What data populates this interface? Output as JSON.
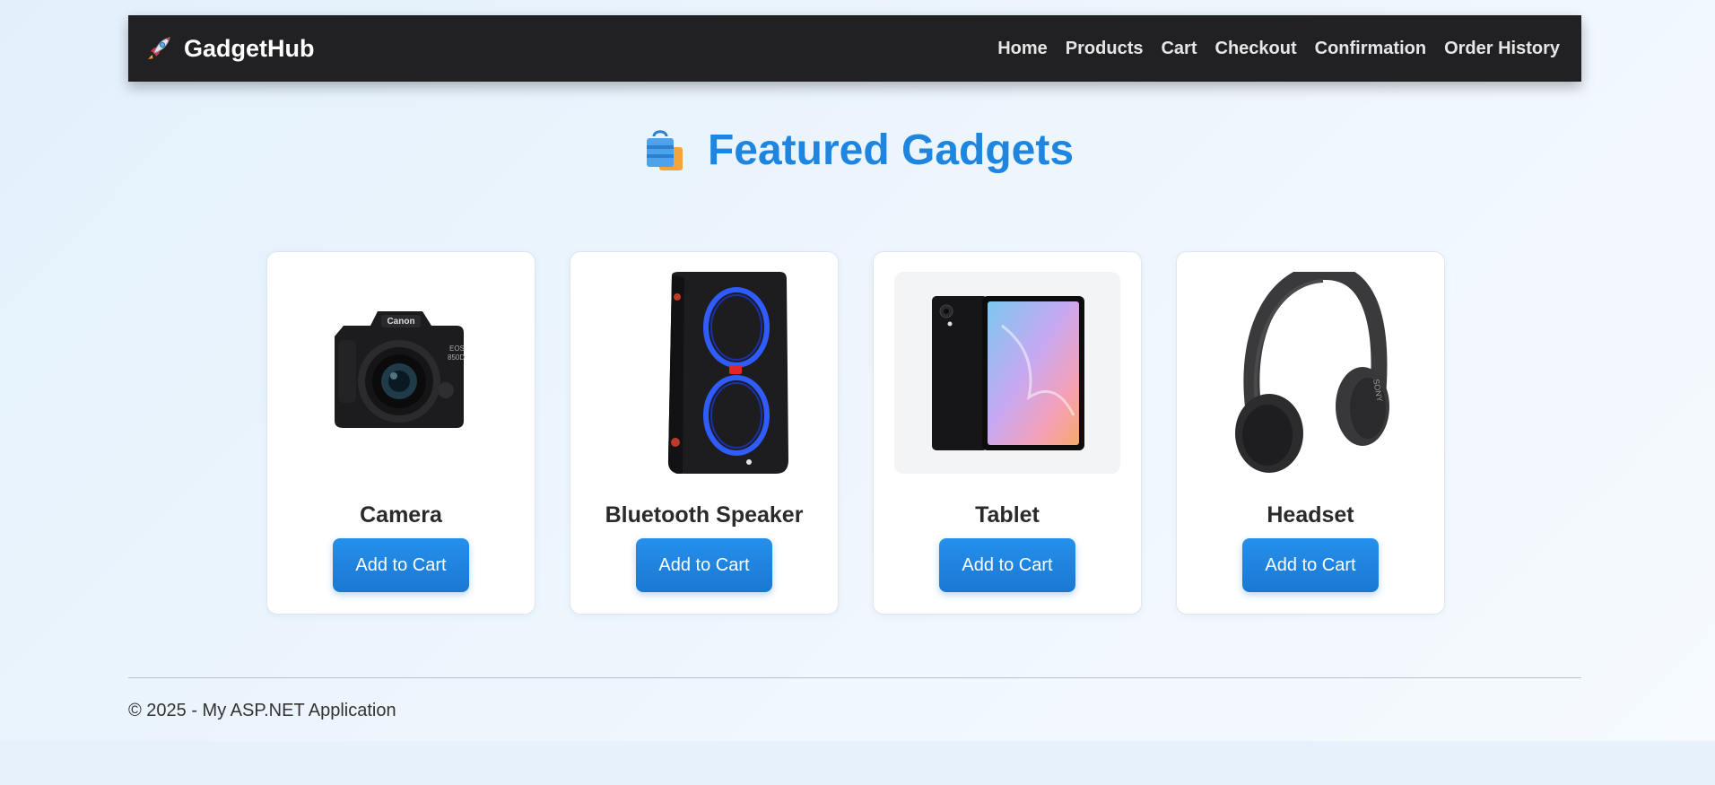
{
  "brand": {
    "name": "GadgetHub",
    "icon": "rocket-icon"
  },
  "nav": {
    "items": [
      {
        "label": "Home"
      },
      {
        "label": "Products"
      },
      {
        "label": "Cart"
      },
      {
        "label": "Checkout"
      },
      {
        "label": "Confirmation"
      },
      {
        "label": "Order History"
      }
    ]
  },
  "main": {
    "title": "Featured Gadgets",
    "title_icon": "shopping-bag-icon",
    "products": [
      {
        "name": "Camera",
        "button": "Add to Cart",
        "image": "camera-image"
      },
      {
        "name": "Bluetooth Speaker",
        "button": "Add to Cart",
        "image": "speaker-image"
      },
      {
        "name": "Tablet",
        "button": "Add to Cart",
        "image": "tablet-image"
      },
      {
        "name": "Headset",
        "button": "Add to Cart",
        "image": "headset-image"
      }
    ]
  },
  "footer": {
    "text": "© 2025 - My ASP.NET Application"
  },
  "colors": {
    "navbar": "#212124",
    "accent": "#1e86e0",
    "button": "#1a78d2",
    "card": "#ffffff"
  }
}
